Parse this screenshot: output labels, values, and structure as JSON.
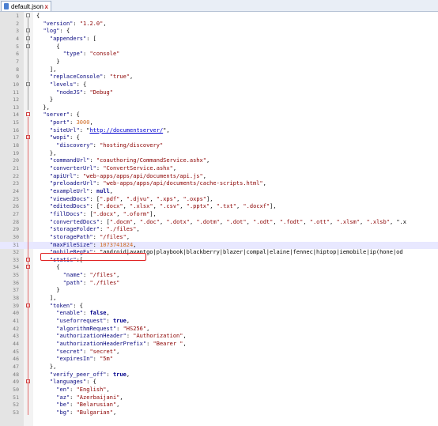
{
  "tab": {
    "title": "default.json",
    "close_glyph": "x"
  },
  "lines": [
    {
      "n": "1",
      "t": "{"
    },
    {
      "n": "2",
      "t": "  \"version\": \"1.2.0\","
    },
    {
      "n": "3",
      "t": "  \"log\": {"
    },
    {
      "n": "4",
      "t": "    \"appenders\": ["
    },
    {
      "n": "5",
      "t": "      {"
    },
    {
      "n": "6",
      "t": "        \"type\": \"console\""
    },
    {
      "n": "7",
      "t": "      }"
    },
    {
      "n": "8",
      "t": "    ],"
    },
    {
      "n": "9",
      "t": "    \"replaceConsole\": \"true\","
    },
    {
      "n": "10",
      "t": "    \"levels\": {"
    },
    {
      "n": "11",
      "t": "      \"nodeJS\": \"Debug\""
    },
    {
      "n": "12",
      "t": "    }"
    },
    {
      "n": "13",
      "t": "  },"
    },
    {
      "n": "14",
      "t": "  \"server\": {"
    },
    {
      "n": "15",
      "t": "    \"port\": 3000,"
    },
    {
      "n": "16",
      "t": "    \"siteUrl\": \"http://documentserver/\","
    },
    {
      "n": "17",
      "t": "    \"wopi\": {"
    },
    {
      "n": "18",
      "t": "      \"discovery\": \"hosting/discovery\""
    },
    {
      "n": "19",
      "t": "    },"
    },
    {
      "n": "20",
      "t": "    \"commandUrl\": \"coauthoring/CommandService.ashx\","
    },
    {
      "n": "21",
      "t": "    \"converterUrl\": \"ConvertService.ashx\","
    },
    {
      "n": "22",
      "t": "    \"apiUrl\": \"web-apps/apps/api/documents/api.js\","
    },
    {
      "n": "23",
      "t": "    \"preloaderUrl\": \"web-apps/apps/api/documents/cache-scripts.html\","
    },
    {
      "n": "24",
      "t": "    \"exampleUrl\": null,"
    },
    {
      "n": "25",
      "t": "    \"viewedDocs\": [\".pdf\", \".djvu\", \".xps\", \".oxps\"],"
    },
    {
      "n": "26",
      "t": "    \"editedDocs\": [\".docx\", \".xlsx\", \".csv\", \".pptx\", \".txt\", \".docxf\"],"
    },
    {
      "n": "27",
      "t": "    \"fillDocs\": [\".docx\", \".oform\"],"
    },
    {
      "n": "28",
      "t": "    \"convertedDocs\": [\".docm\", \".doc\", \".dotx\", \".dotm\", \".dot\", \".odt\", \".fodt\", \".ott\", \".xlsm\", \".xlsb\", \".x"
    },
    {
      "n": "29",
      "t": "    \"storageFolder\": \"./files\","
    },
    {
      "n": "30",
      "t": "    \"storagePath\": \"/files\","
    },
    {
      "n": "31",
      "t": "    \"maxFileSize\": 1073741824,"
    },
    {
      "n": "32",
      "t": "    \"mobileRegEx\": \"android|avantgo|playbook|blackberry|blazer|compal|elaine|fennec|hiptop|iemobile|ip(hone|od"
    },
    {
      "n": "33",
      "t": "    \"static\":["
    },
    {
      "n": "34",
      "t": "      {"
    },
    {
      "n": "35",
      "t": "        \"name\": \"/files\","
    },
    {
      "n": "36",
      "t": "        \"path\": \"./files\""
    },
    {
      "n": "37",
      "t": "      }"
    },
    {
      "n": "38",
      "t": "    ],"
    },
    {
      "n": "39",
      "t": "    \"token\": {"
    },
    {
      "n": "40",
      "t": "      \"enable\": false,"
    },
    {
      "n": "41",
      "t": "      \"useforrequest\": true,"
    },
    {
      "n": "42",
      "t": "      \"algorithmRequest\": \"HS256\","
    },
    {
      "n": "43",
      "t": "      \"authorizationHeader\": \"Authorization\","
    },
    {
      "n": "44",
      "t": "      \"authorizationHeaderPrefix\": \"Bearer \","
    },
    {
      "n": "45",
      "t": "      \"secret\": \"secret\","
    },
    {
      "n": "46",
      "t": "      \"expiresIn\": \"5m\""
    },
    {
      "n": "47",
      "t": "    },"
    },
    {
      "n": "48",
      "t": "    \"verify_peer_off\": true,"
    },
    {
      "n": "49",
      "t": "    \"languages\": {"
    },
    {
      "n": "50",
      "t": "      \"en\": \"English\","
    },
    {
      "n": "51",
      "t": "      \"az\": \"Azerbaijani\","
    },
    {
      "n": "52",
      "t": "      \"be\": \"Belarusian\","
    },
    {
      "n": "53",
      "t": "      \"bg\": \"Bulgarian\","
    }
  ],
  "current_line": "31",
  "highlight_line": "31"
}
